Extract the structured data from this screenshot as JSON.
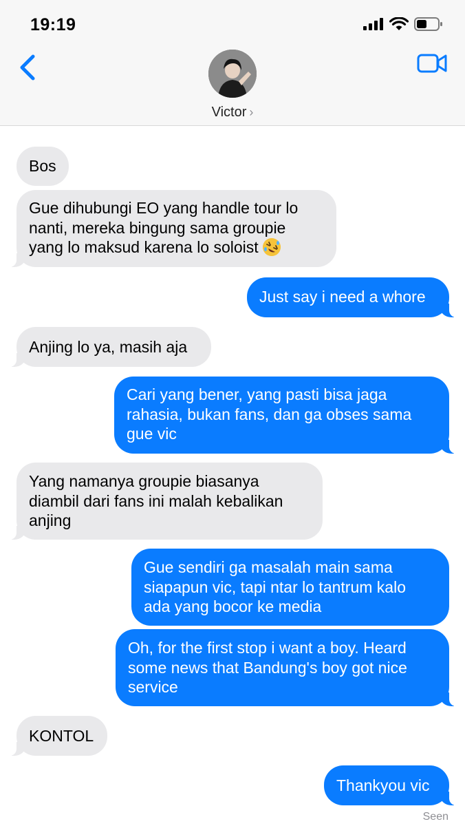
{
  "status_bar": {
    "time": "19:19"
  },
  "header": {
    "contact_name": "Victor"
  },
  "messages": [
    {
      "dir": "in",
      "lines": [
        "Bos"
      ]
    },
    {
      "dir": "in",
      "lines": [
        "Gue dihubungi EO yang handle tour lo",
        "nanti, mereka bingung sama groupie",
        "yang lo maksud karena lo soloist"
      ],
      "emoji": "rolling-on-floor-laughing"
    },
    {
      "dir": "out",
      "lines": [
        "Just say i need a whore"
      ]
    },
    {
      "dir": "in",
      "lines": [
        "Anjing lo ya, masih aja"
      ]
    },
    {
      "dir": "out",
      "lines": [
        "Cari yang bener, yang pasti bisa jaga",
        "rahasia, bukan fans, dan ga obses sama",
        "gue vic"
      ]
    },
    {
      "dir": "in",
      "lines": [
        "Yang namanya groupie biasanya",
        "diambil dari fans ini malah kebalikan",
        "anjing"
      ]
    },
    {
      "dir": "out",
      "lines": [
        "Gue sendiri ga masalah main sama",
        "siapapun vic, tapi ntar lo tantrum kalo",
        "ada yang bocor ke media"
      ]
    },
    {
      "dir": "out",
      "lines": [
        "Oh, for the first stop i want a boy. Heard",
        "some news that Bandung's boy got nice",
        "service"
      ]
    },
    {
      "dir": "in",
      "lines": [
        "KONTOL"
      ]
    },
    {
      "dir": "out",
      "lines": [
        "Thankyou vic"
      ]
    }
  ],
  "receipt": "Seen",
  "colors": {
    "outgoing": "#0a7cff",
    "incoming": "#e9e9eb",
    "accent": "#0a7cff"
  }
}
